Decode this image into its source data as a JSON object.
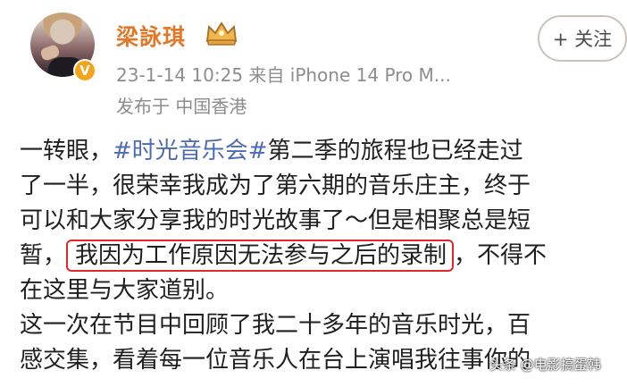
{
  "profile": {
    "username": "梁詠琪",
    "meta": "23-1-14 10:25  来自 iPhone 14 Pro M...",
    "location": "发布于 中国香港",
    "follow_label": "+ 关注",
    "verified_mark": "V"
  },
  "post": {
    "lines": [
      {
        "before": "一转眼，",
        "tag": "#时光音乐会#",
        "after": "第二季的旅程也已经走过"
      },
      {
        "text": "了一半，很荣幸我成为了第六期的音乐庄主，终于"
      },
      {
        "text": "可以和大家分享我的时光故事了～但是相聚总是短"
      },
      {
        "before": "暂，",
        "highlight": "我因为工作原因无法参与之后的录制",
        "after": "，不得不"
      },
      {
        "text": "在这里与大家道别。"
      },
      {
        "text": "这一次在节目中回顾了我二十多年的音乐时光，百"
      },
      {
        "text": "感交集，看着每一位音乐人在台上演唱我往事你的"
      }
    ]
  },
  "watermark": "头条 @电影搞蛋韩",
  "colors": {
    "accent_name": "#e0792a",
    "hashtag": "#4d6bb5",
    "highlight_border": "#e0272b"
  }
}
